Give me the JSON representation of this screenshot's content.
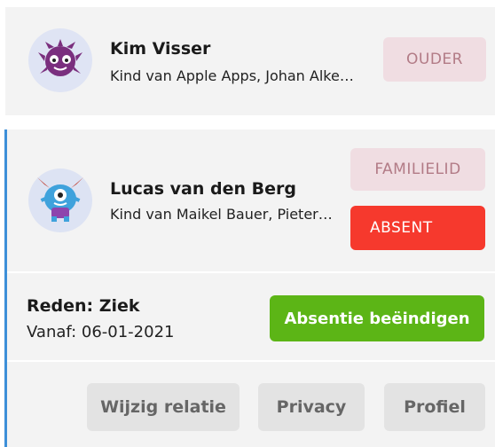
{
  "members": [
    {
      "name": "Kim Visser",
      "subtitle": "Kind van Apple Apps, Johan Alke…",
      "avatar_icon": "purple-monster-icon",
      "role_label": "OUDER"
    },
    {
      "name": "Lucas van den Berg",
      "subtitle": "Kind van Maikel Bauer, Pieter…",
      "avatar_icon": "blue-monster-icon",
      "role_label": "FAMILIELID",
      "status_label": "ABSENT",
      "absence": {
        "reason": "Reden: Ziek",
        "since": "Vanaf: 06-01-2021",
        "end_button": "Absentie beëindigen"
      },
      "actions": [
        "Wijzig relatie",
        "Privacy",
        "Profiel"
      ]
    }
  ],
  "colors": {
    "absent": "#f6392d",
    "end_button": "#5cb516",
    "role_pill": "#f0dde2",
    "accent_border": "#3d8fd8"
  }
}
